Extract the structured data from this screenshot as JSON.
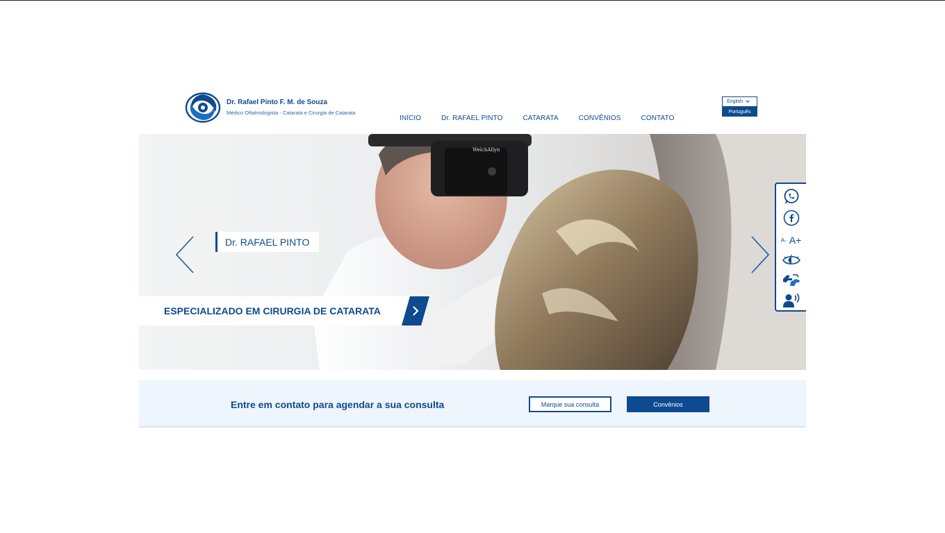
{
  "header": {
    "brand_name": "Dr. Rafael Pinto F. M. de Souza",
    "brand_subtitle": "Médico Oftalmologista - Catarata e Cirurgia de Catarata",
    "nav": [
      {
        "label": "INÍCIO"
      },
      {
        "label": "Dr. RAFAEL PINTO"
      },
      {
        "label": "CATARATA"
      },
      {
        "label": "CONVÊNIOS"
      },
      {
        "label": "CONTATO"
      }
    ],
    "language": {
      "current": "English",
      "option": "Português"
    }
  },
  "hero": {
    "tag": "Dr. RAFAEL PINTO",
    "banner": "ESPECIALIZADO EM CIRURGIA DE CATARATA",
    "device_label": "WelchAllyn"
  },
  "accessibility": {
    "font_decrease": "A-",
    "font_increase": "A+",
    "icons": [
      "whatsapp-icon",
      "facebook-icon",
      "font-size-icon",
      "contrast-eye-icon",
      "sign-language-icon",
      "screen-reader-icon"
    ]
  },
  "cta": {
    "text": "Entre em contato para agendar a sua consulta",
    "button_primary": "Marque sua consulta",
    "button_secondary": "Convênios"
  },
  "colors": {
    "brand": "#0d4a8f",
    "cta_background": "#eef5fc"
  }
}
